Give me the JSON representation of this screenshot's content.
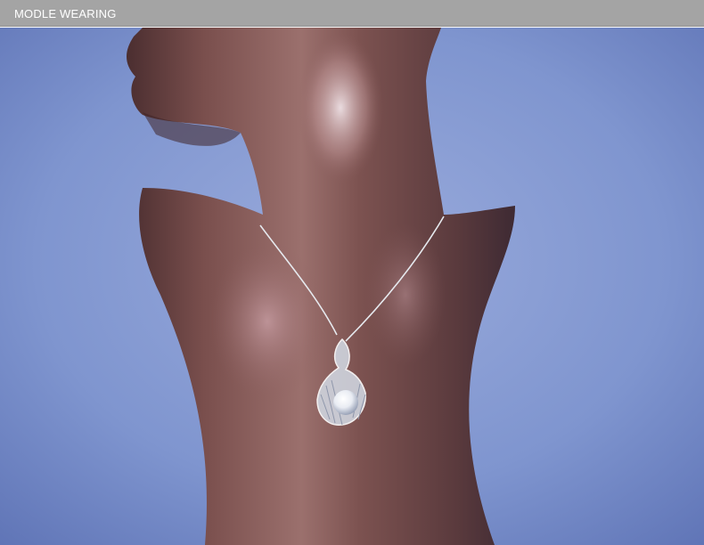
{
  "header": {
    "title": "MODLE WEARING",
    "bar_color": "#a4a4a4"
  },
  "photo": {
    "background_color": "#7e94cc",
    "mannequin_color": "#7a4f4a",
    "necklace_color": "#e6e9ee"
  }
}
